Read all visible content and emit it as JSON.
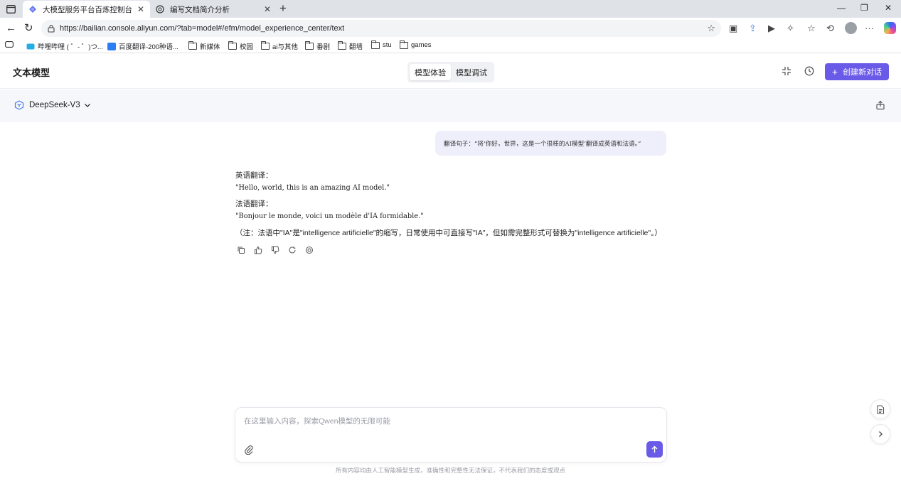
{
  "browser": {
    "tabs": [
      {
        "title": "大模型服务平台百炼控制台",
        "active": true
      },
      {
        "title": "编写文档简介分析",
        "active": false
      }
    ],
    "url": "https://bailian.console.aliyun.com/?tab=model#/efm/model_experience_center/text",
    "bookmarks": [
      "哔哩哔哩 ( ゜- ゜)つ...",
      "百度翻译-200种语...",
      "新媒体",
      "校园",
      "ai与其他",
      "番剧",
      "翻墙",
      "stu",
      "games"
    ]
  },
  "header": {
    "title": "文本模型",
    "tabs": [
      "模型体验",
      "模型调试"
    ],
    "active_tab": "模型体验",
    "create_label": "创建新对话"
  },
  "model": {
    "name": "DeepSeek-V3"
  },
  "chat": {
    "user_message": "翻译句子：“将‘你好，世界，这是一个很棒的AI模型’翻译成英语和法语。”",
    "answer": {
      "en_label": "英语翻译：",
      "en_text": "\"Hello, world, this is an amazing AI model.\"",
      "fr_label": "法语翻译：",
      "fr_text": "\"Bonjour le monde, voici un modèle d'IA formidable.\"",
      "note": "（注：法语中\"IA\"是\"intelligence artificielle\"的缩写，日常使用中可直接写\"IA\"，但如需完整形式可替换为\"intelligence artificielle\"。）"
    }
  },
  "composer": {
    "placeholder": "在这里输入内容，探索Qwen模型的无限可能",
    "disclaimer": "所有内容均由人工智能模型生成，准确性和完整性无法保证，不代表我们的态度或观点"
  },
  "colors": {
    "accent": "#6a5ae8",
    "bubble": "#efeefb"
  }
}
